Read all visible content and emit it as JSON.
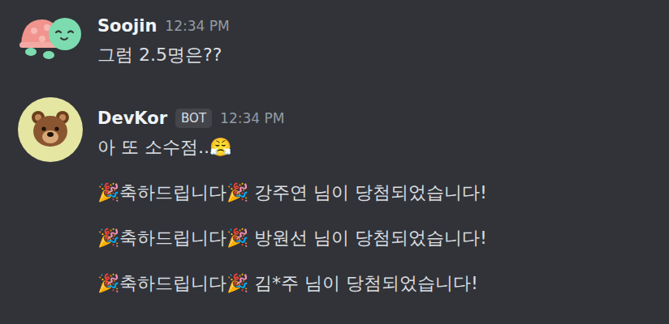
{
  "messages": [
    {
      "author": "Soojin",
      "bot": false,
      "time": "12:34 PM",
      "lines": [
        "그럼 2.5명은??"
      ]
    },
    {
      "author": "DevKor",
      "bot": true,
      "badge": "BOT",
      "time": "12:34 PM",
      "lines": [
        "아 또 소수점..😤",
        "🎉축하드립니다🎉 강주연 님이 당첨되었습니다!",
        "🎉축하드립니다🎉 방원선 님이 당첨되었습니다!",
        "🎉축하드립니다🎉 김*주 님이 당첨되었습니다!"
      ]
    }
  ]
}
